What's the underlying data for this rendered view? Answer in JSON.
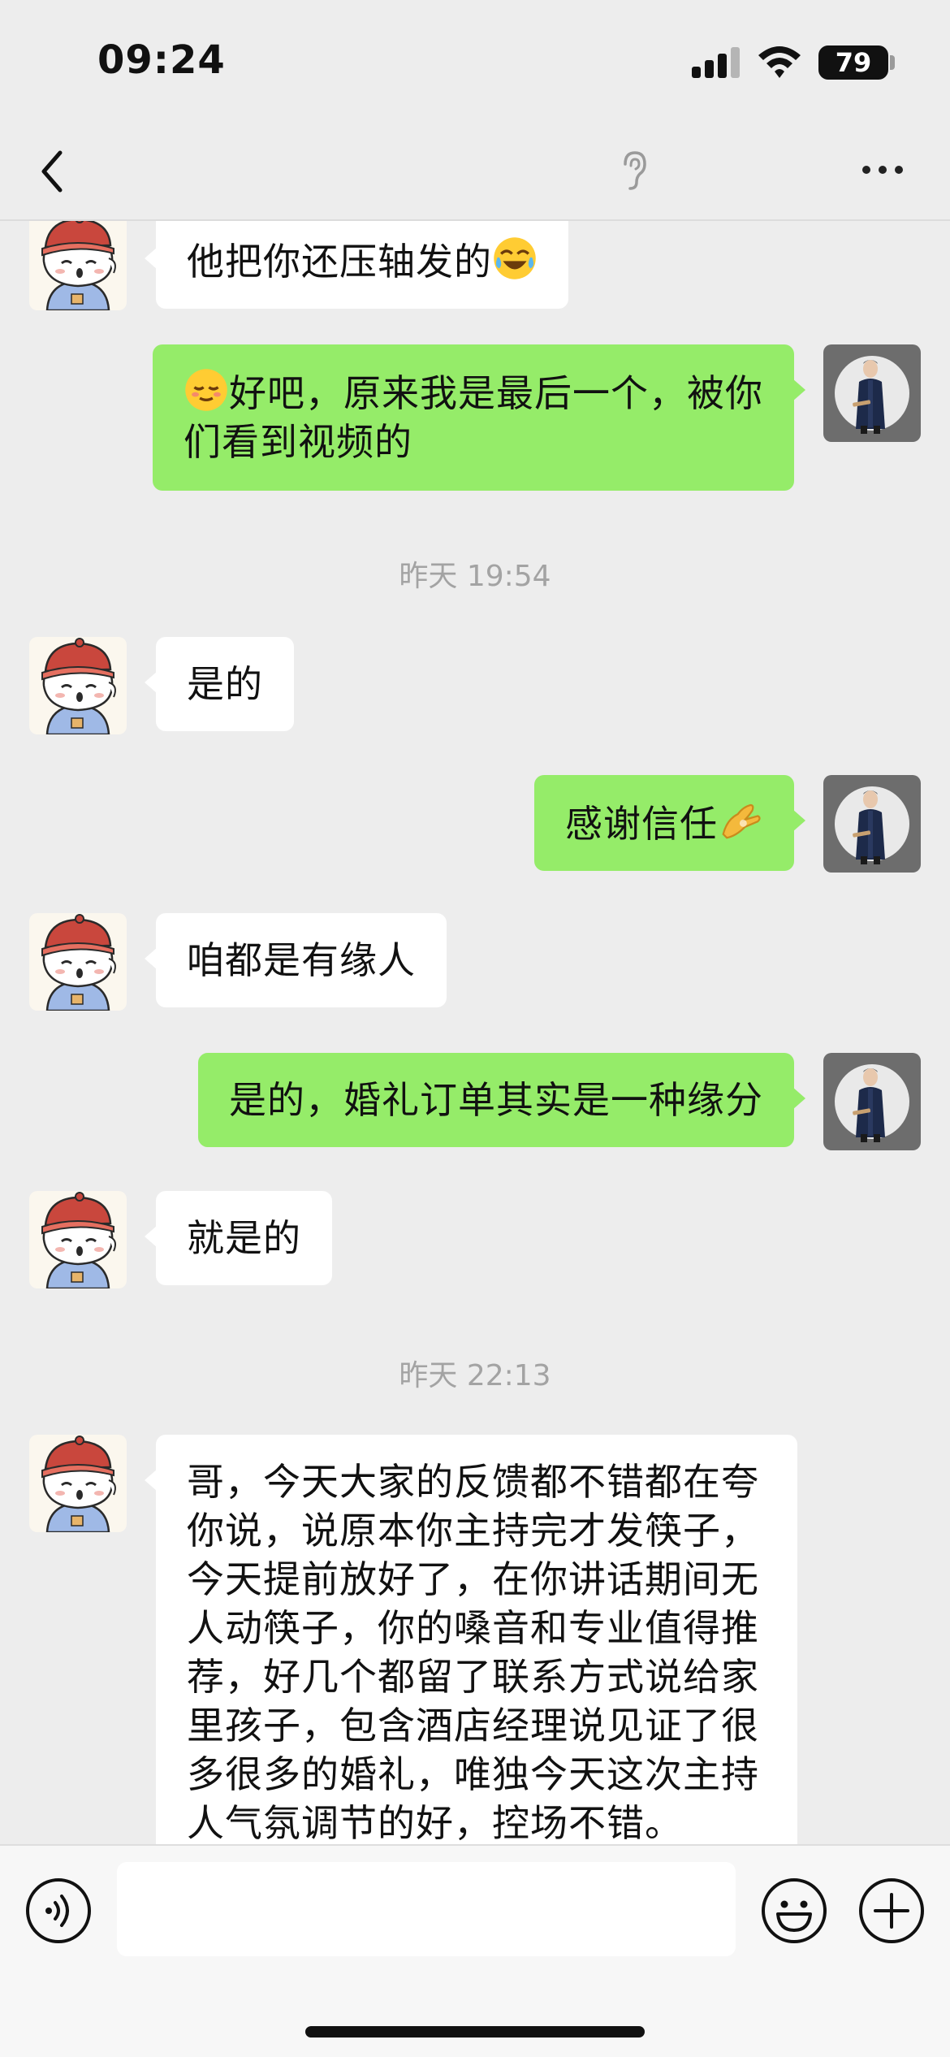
{
  "status_bar": {
    "time": "09:24",
    "battery": "79"
  },
  "nav": {
    "title": ""
  },
  "messages": [
    {
      "side": "left",
      "text": "他把你还压轴发的"
    },
    {
      "side": "right",
      "text_line1": "好吧，原来我是最后一个，被你",
      "text_line2": "们看到视频的"
    },
    {
      "type": "timestamp",
      "text": "昨天 19:54"
    },
    {
      "side": "left",
      "text": "是的"
    },
    {
      "side": "right",
      "text": "感谢信任"
    },
    {
      "side": "left",
      "text": "咱都是有缘人"
    },
    {
      "side": "right",
      "text": "是的，婚礼订单其实是一种缘分"
    },
    {
      "side": "left",
      "text": "就是的"
    },
    {
      "type": "timestamp",
      "text": "昨天 22:13"
    },
    {
      "side": "left",
      "lines": [
        "哥，今天大家的反馈都不错都在夸",
        "你说，说原本你主持完才发筷子，",
        "今天提前放好了，在你讲话期间无",
        "人动筷子，你的嗓音和专业值得推",
        "荐，好几个都留了联系方式说给家",
        "里孩子，包含酒店经理说见证了很",
        "多很多的婚礼，唯独今天这次主持",
        "人气氛调节的好，控场不错。"
      ]
    }
  ],
  "input": {
    "placeholder": ""
  },
  "icons": {
    "back": "chevron-left-icon",
    "ear": "ear-icon",
    "more": "more-icon",
    "voice": "voice-icon",
    "emoji": "emoji-icon",
    "plus": "plus-icon"
  },
  "colors": {
    "background": "#ededed",
    "sent_bubble": "#95ec69",
    "received_bubble": "#ffffff",
    "timestamp": "#a3a3a3"
  }
}
